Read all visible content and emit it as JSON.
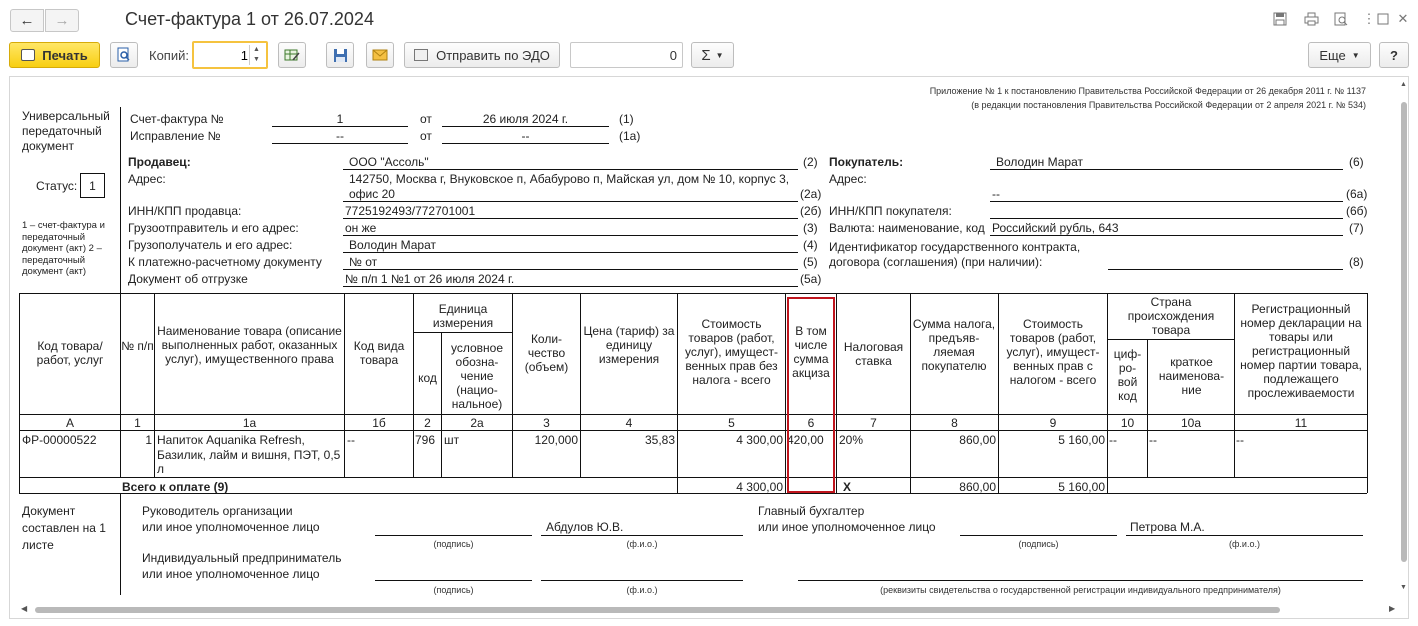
{
  "window": {
    "title": "Счет-фактура 1 от 26.07.2024",
    "icons": [
      "save-icon",
      "print-icon",
      "preview-icon",
      "more-icon",
      "maximize-icon",
      "close-icon"
    ]
  },
  "toolbar": {
    "print_label": "Печать",
    "copies_label": "Копий:",
    "copies_value": "1",
    "edo_label": "Отправить по ЭДО",
    "counter_value": "0",
    "sigma_label": "Σ",
    "more_label": "Еще",
    "help_label": "?"
  },
  "doc": {
    "appendix_line1": "Приложение № 1 к постановлению Правительства Российской Федерации от 26 декабря 2011 г. № 1137",
    "appendix_line2": "(в редакции постановления Правительства Российской Федерации от 2 апреля 2021 г. № 534)",
    "upd_title": "Универсальный передаточный документ",
    "status_label": "Статус:",
    "status_value": "1",
    "status_note": "1 – счет-фактура и передаточный документ (акт) 2 – передаточный документ (акт)",
    "invoice_label": "Счет-фактура №",
    "invoice_number": "1",
    "from_label": "от",
    "invoice_date": "26 июля 2024 г.",
    "invoice_code": "(1)",
    "correction_label": "Исправление №",
    "correction_number": "--",
    "correction_date": "--",
    "correction_code": "(1а)",
    "seller": {
      "title": "Продавец:",
      "name": "ООО \"Ассоль\"",
      "name_code": "(2)",
      "address_label": "Адрес:",
      "address_line1": "142750, Москва г, Внуковское п, Абабурово п, Майская ул, дом № 10, корпус 3,",
      "address_line2": "офис 20",
      "address_code": "(2а)",
      "inn_label": "ИНН/КПП продавца:",
      "inn": "7725192493/772701001",
      "inn_code": "(2б)",
      "shipper_label": "Грузоотправитель и его адрес:",
      "shipper": "он же",
      "shipper_code": "(3)",
      "consignee_label": "Грузополучатель и его адрес:",
      "consignee": "Володин Марат",
      "consignee_code": "(4)",
      "payment_label": "К платежно-расчетному документу",
      "payment": "№   от",
      "payment_code": "(5)",
      "shipment_label": "Документ об отгрузке",
      "shipment": "№ п/п 1 №1 от 26 июля 2024 г.",
      "shipment_code": "(5а)"
    },
    "buyer": {
      "title": "Покупатель:",
      "name": "Володин Марат",
      "name_code": "(6)",
      "address_label": "Адрес:",
      "address": "--",
      "address_code": "(6а)",
      "inn_label": "ИНН/КПП покупателя:",
      "inn_code": "(6б)",
      "currency_label": "Валюта: наименование, код",
      "currency": "Российский рубль, 643",
      "currency_code": "(7)",
      "contract_label_line1": "Идентификатор государственного контракта,",
      "contract_label_line2": "договора (соглашения) (при наличии):",
      "contract_code": "(8)"
    },
    "table": {
      "headers": {
        "code": "Код товара/ работ, услуг",
        "num": "№ п/п",
        "name": "Наименование товара (описание выполненных работ, оказанных услуг), имущественного права",
        "kind": "Код вида товара",
        "unit_group": "Единица измерения",
        "unit_code": "код",
        "unit_name": "условное обозна- чение (нацио- нальное)",
        "qty": "Коли- чество (объем)",
        "price": "Цена (тариф) за единицу измерения",
        "cost": "Стоимость товаров (работ, услуг), имущест- венных прав без налога - всего",
        "excise": "В том числе сумма акциза",
        "rate": "Налоговая ставка",
        "tax": "Сумма налога, предъяв- ляемая покупателю",
        "total": "Стоимость товаров (работ, услуг), имущест- венных прав с налогом - всего",
        "country_group": "Страна происхождения товара",
        "country_code": "циф- ро- вой код",
        "country_name": "краткое наименова- ние",
        "reg": "Регистрационный номер декларации на товары или регистрационный номер партии товара, подлежащего прослеживаемости"
      },
      "column_numbers": [
        "А",
        "1",
        "1а",
        "1б",
        "2",
        "2а",
        "3",
        "4",
        "5",
        "6",
        "7",
        "8",
        "9",
        "10",
        "10а",
        "11"
      ],
      "rows": [
        {
          "code": "ФР-00000522",
          "num": "1",
          "name": "Напиток Aquanika Refresh, Базилик, лайм и вишня, ПЭТ, 0,5 л",
          "kind": "--",
          "unit_code": "796",
          "unit_name": "шт",
          "qty": "120,000",
          "price": "35,83",
          "cost": "4 300,00",
          "excise": "420,00",
          "rate": "20%",
          "tax": "860,00",
          "total": "5 160,00",
          "country_code": "--",
          "country_name": "--",
          "reg": "--"
        }
      ],
      "totals": {
        "label": "Всего к оплате (9)",
        "cost": "4 300,00",
        "excise": "X",
        "tax": "860,00",
        "total": "5 160,00"
      }
    },
    "footer": {
      "sheets_label": "Документ составлен на 1 листе",
      "head_label_line1": "Руководитель организации",
      "head_label_line2": "или иное уполномоченное лицо",
      "head_name": "Абдулов Ю.В.",
      "accountant_label_line1": "Главный бухгалтер",
      "accountant_label_line2": "или иное уполномоченное лицо",
      "accountant_name": "Петрова М.А.",
      "ip_label_line1": "Индивидуальный предприниматель",
      "ip_label_line2": "или иное уполномоченное лицо",
      "signature_hint": "(подпись)",
      "fio_hint": "(ф.и.о.)",
      "ip_requisites_hint": "(реквизиты свидетельства о государственной  регистрации индивидуального предпринимателя)"
    }
  },
  "highlight_color": "#c0151e"
}
